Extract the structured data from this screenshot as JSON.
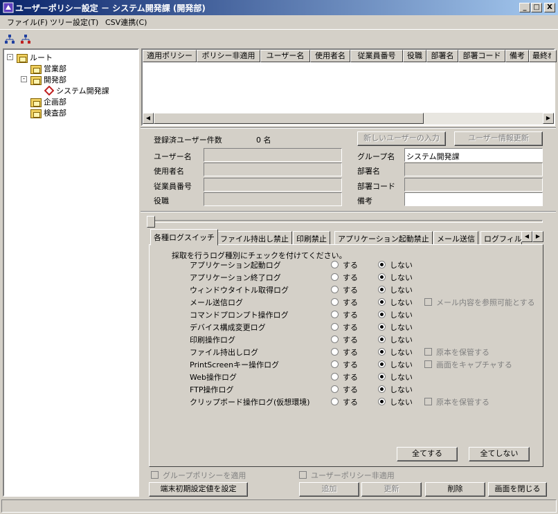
{
  "window": {
    "title": "ユーザーポリシー設定 － システム開発課 (開発部)"
  },
  "caption_buttons": {
    "minimize": "_",
    "maximize": "□",
    "close": "X"
  },
  "menu": [
    "ファイル(F)",
    "ツリー設定(T)",
    "CSV連携(C)"
  ],
  "tree": {
    "root": "ルート",
    "nodes": [
      "営業部",
      "開発部",
      "システム開発課",
      "企画部",
      "検査部"
    ]
  },
  "grid": {
    "columns": [
      "適用ポリシー",
      "ポリシー非適用",
      "ユーザー名",
      "使用者名",
      "従業員番号",
      "役職",
      "部署名",
      "部署コード",
      "備考",
      "最終ｵ"
    ]
  },
  "details": {
    "count_label": "登録済ユーザー件数",
    "count_value": "0 名",
    "new_user_button": "新しいユーザーの入力",
    "update_button": "ユーザー情報更新",
    "user_name_label": "ユーザー名",
    "user_label": "使用者名",
    "employee_no_label": "従業員番号",
    "position_label": "役職",
    "group_label": "グループ名",
    "group_value": "システム開発課",
    "dept_label": "部署名",
    "dept_code_label": "部署コード",
    "remarks_label": "備考"
  },
  "tabs": [
    "各種ログスイッチ",
    "ファイル持出し禁止",
    "印刷禁止",
    "アプリケーション起動禁止",
    "メール送信",
    "ログフィル"
  ],
  "log_panel": {
    "instruction": "採取を行うログ種別にチェックを付けてください。",
    "on_label": "する",
    "off_label": "しない",
    "rows": [
      {
        "name": "アプリケーション起動ログ",
        "selected": "off",
        "extra": ""
      },
      {
        "name": "アプリケーション終了ログ",
        "selected": "off",
        "extra": ""
      },
      {
        "name": "ウィンドウタイトル取得ログ",
        "selected": "off",
        "extra": ""
      },
      {
        "name": "メール送信ログ",
        "selected": "off",
        "extra": "メール内容を参照可能とする"
      },
      {
        "name": "コマンドプロンプト操作ログ",
        "selected": "off",
        "extra": ""
      },
      {
        "name": "デバイス構成変更ログ",
        "selected": "off",
        "extra": ""
      },
      {
        "name": "印刷操作ログ",
        "selected": "off",
        "extra": ""
      },
      {
        "name": "ファイル持出しログ",
        "selected": "off",
        "extra": "原本を保管する"
      },
      {
        "name": "PrintScreenキー操作ログ",
        "selected": "off",
        "extra": "画面をキャプチャする"
      },
      {
        "name": "Web操作ログ",
        "selected": "off",
        "extra": ""
      },
      {
        "name": "FTP操作ログ",
        "selected": "off",
        "extra": ""
      },
      {
        "name": "クリップボード操作ログ(仮想環境)",
        "selected": "off",
        "extra": "原本を保管する"
      }
    ],
    "all_on_button": "全てする",
    "all_off_button": "全てしない"
  },
  "footer": {
    "apply_group_policy": "グループポリシーを適用",
    "user_policy_off": "ユーザーポリシー非適用",
    "init_terminal_button": "端末初期設定値を設定",
    "add_button": "追加",
    "update_button": "更新",
    "delete_button": "削除",
    "close_button": "画面を閉じる"
  }
}
